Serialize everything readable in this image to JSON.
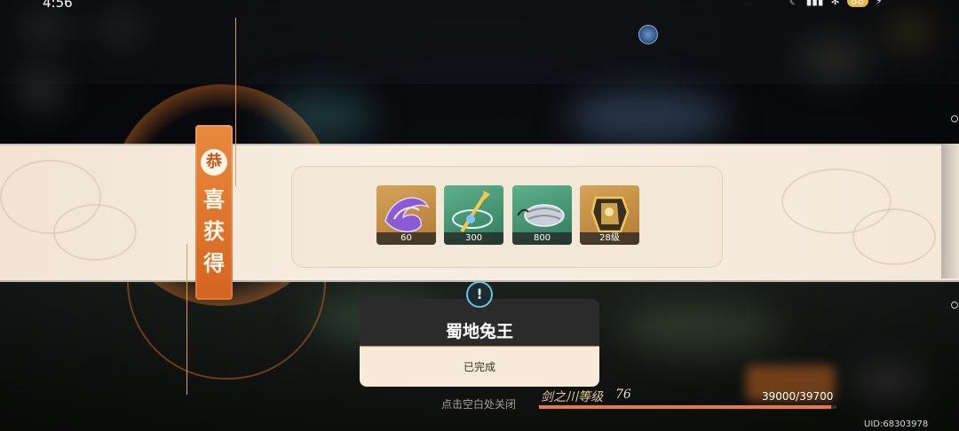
{
  "status_bar": {
    "time": "4:56",
    "battery": "88"
  },
  "reward_banner": {
    "badge_char": "恭",
    "label_chars": [
      "喜",
      "获",
      "得"
    ],
    "items": [
      {
        "count": "60",
        "icon": "purple-feather-icon",
        "bg": "orange"
      },
      {
        "count": "300",
        "icon": "golden-weapon-icon",
        "bg": "green"
      },
      {
        "count": "800",
        "icon": "silver-scroll-icon",
        "bg": "green"
      },
      {
        "count": "28级",
        "icon": "golden-armor-icon",
        "bg": "orange"
      }
    ]
  },
  "quest_card": {
    "title": "蜀地兔王",
    "status": "已完成"
  },
  "footer": {
    "close_hint": "点击空白处关闭",
    "level_label": "剑之川等级",
    "level_value": "76",
    "xp_text": "39000/39700",
    "xp_fraction": 0.9824,
    "uid": "UID:68303978"
  },
  "colors": {
    "accent": "#e97b3b",
    "banner": "#f4e8d8",
    "card_dark": "#2c2b2c"
  }
}
